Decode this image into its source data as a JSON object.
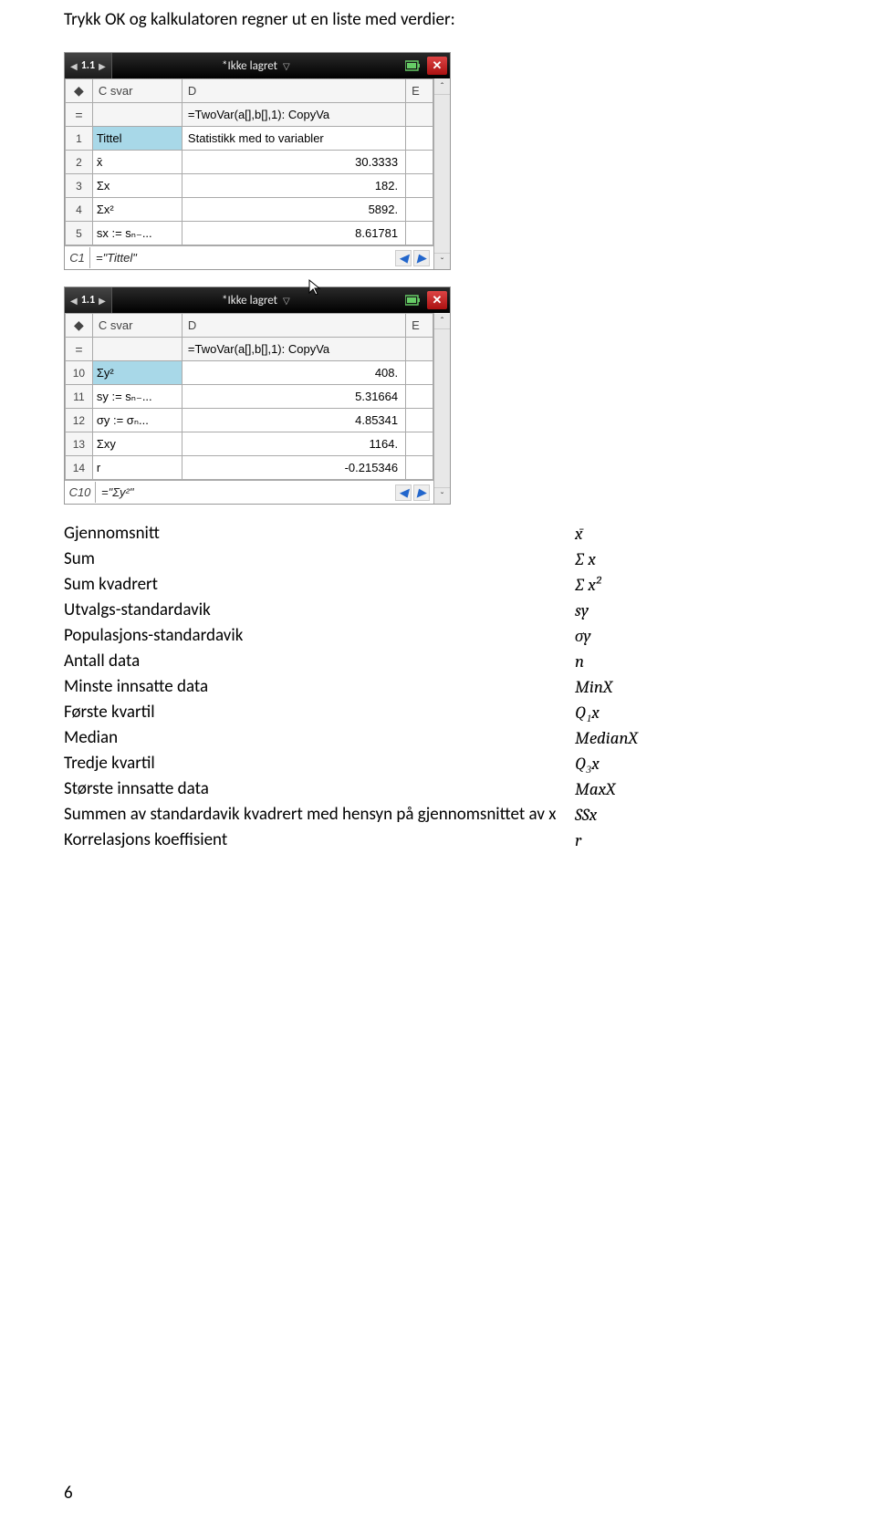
{
  "intro": "Trykk OK og kalkulatoren regner ut en liste med verdier:",
  "page_num": "6",
  "calc1": {
    "tab": "1.1",
    "title": "*Ikke lagret",
    "cols": {
      "c": "C",
      "c_name": "svar",
      "d": "D",
      "e": "E"
    },
    "formula": "=TwoVar(a[],b[],1): CopyVa",
    "rows": [
      {
        "n": "1",
        "c": "Tittel",
        "d": "Statistikk med to variabler",
        "d_left": true,
        "sel": true
      },
      {
        "n": "2",
        "c": "x̄",
        "d": "30.3333"
      },
      {
        "n": "3",
        "c": "Σx",
        "d": "182."
      },
      {
        "n": "4",
        "c": "Σx²",
        "d": "5892."
      },
      {
        "n": "5",
        "c": "sx := sₙ₋...",
        "d": "8.61781"
      }
    ],
    "ref_label": "C1",
    "ref_value": "=\"Tittel\""
  },
  "calc2": {
    "tab": "1.1",
    "title": "*Ikke lagret",
    "cols": {
      "c": "C",
      "c_name": "svar",
      "d": "D",
      "e": "E"
    },
    "formula": "=TwoVar(a[],b[],1): CopyVa",
    "rows": [
      {
        "n": "10",
        "c": "Σy²",
        "d": "408.",
        "sel": true
      },
      {
        "n": "11",
        "c": "sy := sₙ₋...",
        "d": "5.31664"
      },
      {
        "n": "12",
        "c": "σy := σₙ...",
        "d": "4.85341"
      },
      {
        "n": "13",
        "c": "Σxy",
        "d": "1164."
      },
      {
        "n": "14",
        "c": "r",
        "d": "-0.215346"
      }
    ],
    "ref_label": "C10",
    "ref_value": "=\"Σy²\""
  },
  "defs": [
    {
      "label": "Gjennomsnitt",
      "sym": "x̄"
    },
    {
      "label": "Sum",
      "sym": "∑ x"
    },
    {
      "label": "Sum kvadrert",
      "sym": "∑ x²"
    },
    {
      "label": "Utvalgs-standardavik",
      "sym": "sy"
    },
    {
      "label": "Populasjons-standardavik",
      "sym": "σy"
    },
    {
      "label": "Antall data",
      "sym": "n"
    },
    {
      "label": "Minste innsatte data",
      "sym": "MinX"
    },
    {
      "label": "Første kvartil",
      "sym": "Q₁x"
    },
    {
      "label": "Median",
      "sym": "MedianX"
    },
    {
      "label": "Tredje kvartil",
      "sym": "Q₃x"
    },
    {
      "label": "Største innsatte data",
      "sym": "MaxX"
    },
    {
      "label": "Summen av standardavik kvadrert med hensyn på gjennomsnittet av x",
      "sym": "SSx"
    },
    {
      "label": "Korrelasjons koeffisient",
      "sym": "r"
    }
  ]
}
